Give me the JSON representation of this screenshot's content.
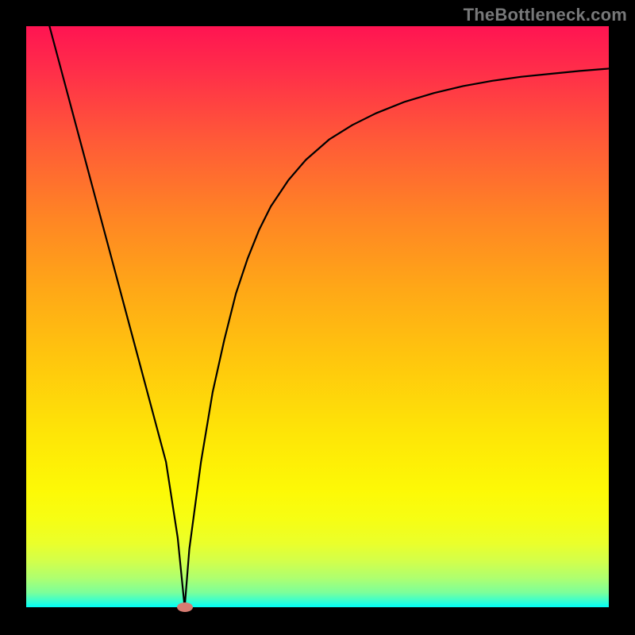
{
  "watermark": "TheBottleneck.com",
  "chart_data": {
    "type": "line",
    "title": "",
    "xlabel": "",
    "ylabel": "",
    "xlim": [
      0,
      100
    ],
    "ylim": [
      0,
      100
    ],
    "grid": false,
    "legend": false,
    "series": [
      {
        "name": "curve",
        "x": [
          0,
          2,
          4,
          6,
          8,
          10,
          12,
          14,
          16,
          18,
          20,
          22,
          24,
          26,
          27.2,
          28,
          30,
          32,
          34,
          36,
          38,
          40,
          42,
          45,
          48,
          52,
          56,
          60,
          65,
          70,
          75,
          80,
          85,
          90,
          95,
          100
        ],
        "values": [
          115,
          107.5,
          100,
          92.5,
          85,
          77.5,
          70,
          62.5,
          55,
          47.5,
          40,
          32.5,
          25,
          12,
          0,
          10,
          25,
          37,
          46,
          54,
          60,
          65,
          69,
          73.5,
          77,
          80.5,
          83,
          85,
          87,
          88.5,
          89.7,
          90.6,
          91.3,
          91.8,
          92.3,
          92.7
        ],
        "color": "#000000"
      }
    ],
    "markers": [
      {
        "name": "min-point",
        "x": 27.2,
        "y": 0,
        "color": "#d77c72"
      }
    ],
    "background": "red-yellow-green-gradient"
  }
}
